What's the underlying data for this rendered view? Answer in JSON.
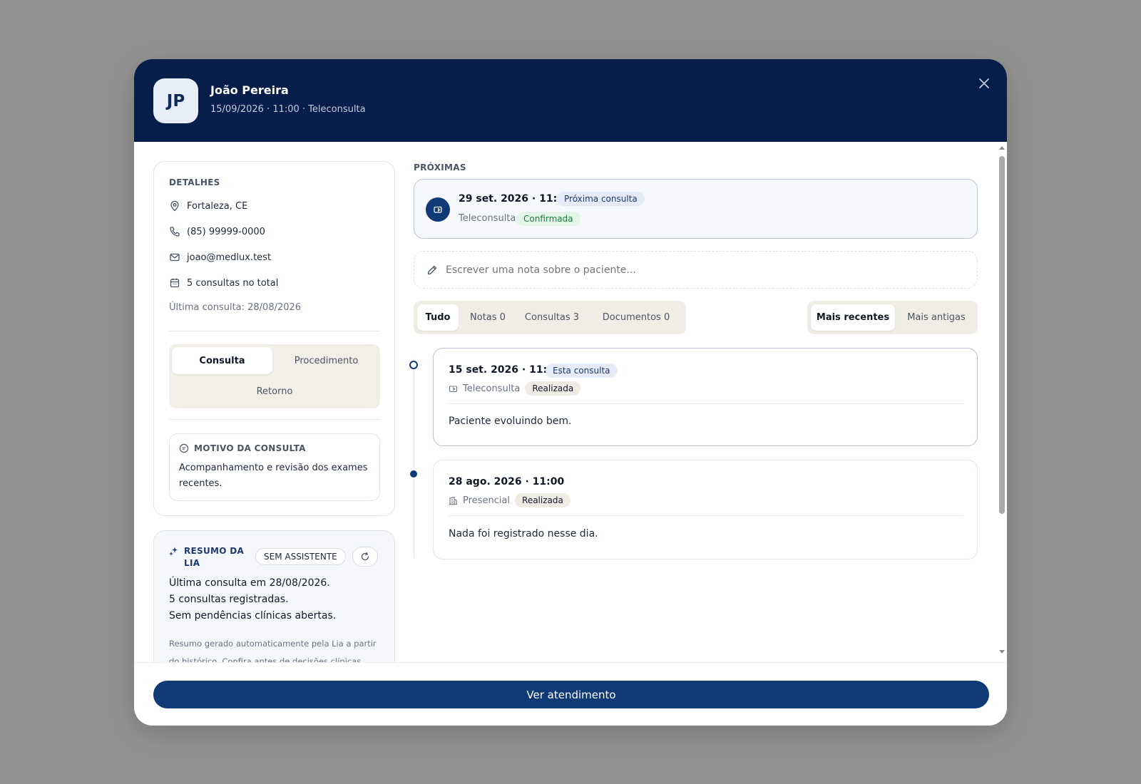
{
  "header": {
    "avatar_initials": "JP",
    "patient_name": "João Pereira",
    "subtitle": "15/09/2026 · 11:00 · Teleconsulta"
  },
  "details": {
    "title": "DETALHES",
    "location": "Fortaleza, CE",
    "phone": "(85) 99999-0000",
    "email": "joao@medlux.test",
    "total_consultations": "5 consultas no total",
    "last_consultation": "Última consulta: 28/08/2026",
    "types": [
      "Consulta",
      "Procedimento",
      "Retorno"
    ],
    "selected_type": "Consulta",
    "motivo_title": "MOTIVO DA CONSULTA",
    "motivo_text": "Acompanhamento e revisão dos exames recentes."
  },
  "lia": {
    "title": "RESUMO DA LIA",
    "badge": "SEM ASSISTENTE",
    "lines": [
      "Última consulta em 28/08/2026.",
      "5 consultas registradas.",
      "Sem pendências clínicas abertas."
    ],
    "footer": "Resumo gerado automaticamente pela Lia a partir do histórico. Confira antes de decisões clínicas."
  },
  "upcoming": {
    "title": "PRÓXIMAS",
    "date": "29 set. 2026 · 11:00",
    "badge": "Próxima consulta",
    "mode": "Teleconsulta",
    "status": "Confirmada"
  },
  "note": {
    "placeholder": "Escrever uma nota sobre o paciente..."
  },
  "filters": [
    {
      "label": "Tudo",
      "active": true
    },
    {
      "label": "Notas 0",
      "active": false
    },
    {
      "label": "Consultas 3",
      "active": false
    },
    {
      "label": "Documentos 0",
      "active": false
    }
  ],
  "sort": [
    {
      "label": "Mais recentes",
      "active": true
    },
    {
      "label": "Mais antigas",
      "active": false
    }
  ],
  "timeline": [
    {
      "date": "15 set. 2026 · 11:00",
      "badge": "Esta consulta",
      "mode": "Teleconsulta",
      "status": "Realizada",
      "text": "Paciente evoluindo bem."
    },
    {
      "date": "28 ago. 2026 · 11:00",
      "badge": "",
      "mode": "Presencial",
      "status": "Realizada",
      "text": "Nada foi registrado nesse dia."
    }
  ],
  "footer": {
    "primary_label": "Ver atendimento"
  },
  "colors": {
    "header_bg": "#071e4b",
    "primary": "#0f3a75",
    "confirmed_green": "#1d7a3d",
    "backdrop": "#929290"
  }
}
